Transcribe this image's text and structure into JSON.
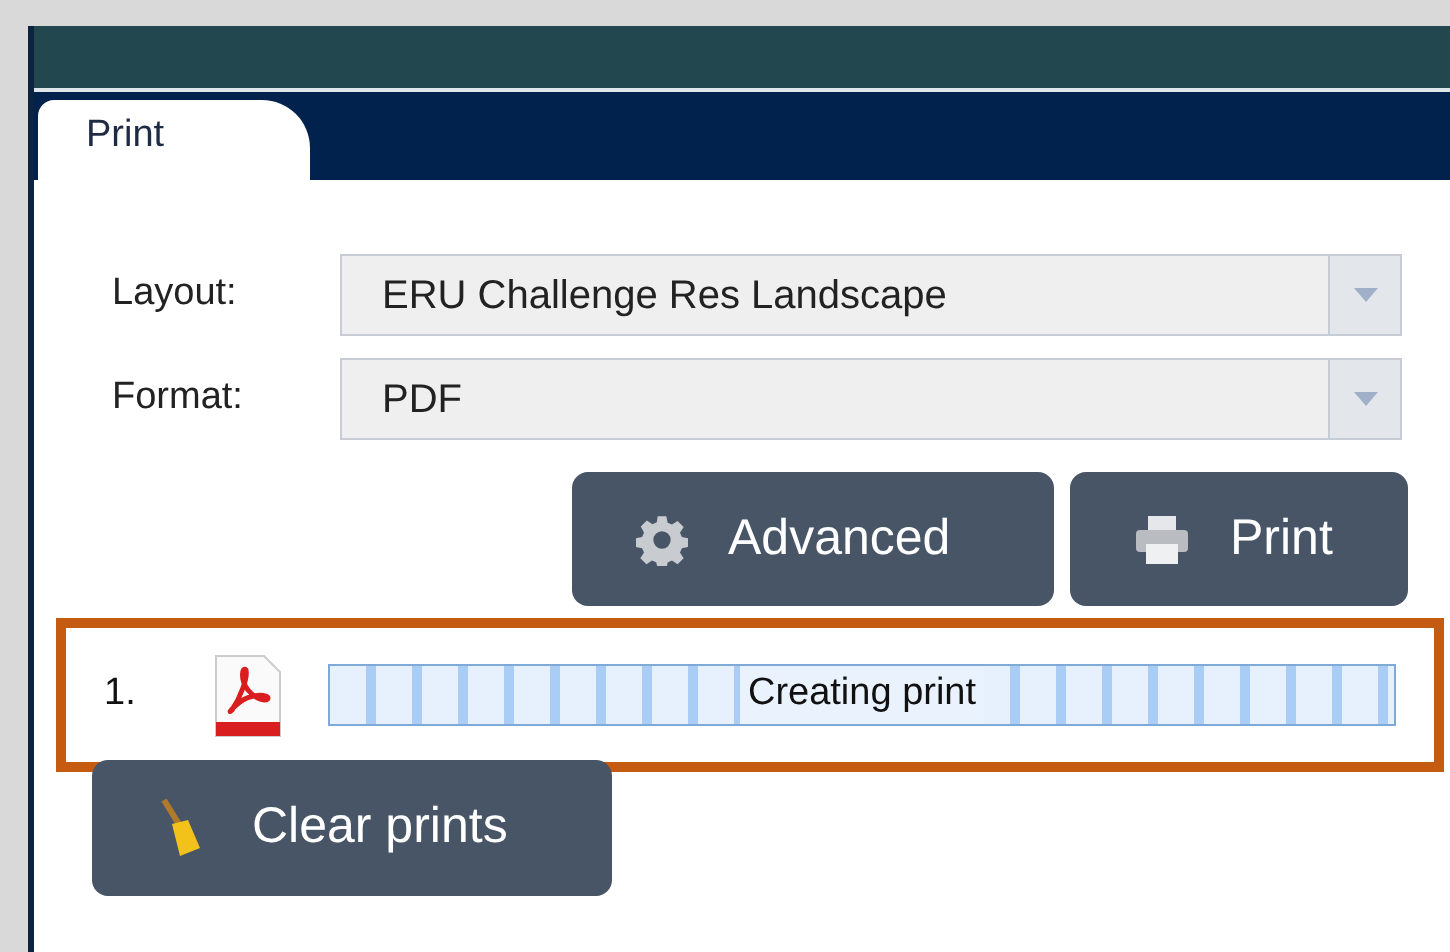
{
  "tabs": [
    {
      "label": "Print",
      "selected": true
    }
  ],
  "fields": [
    {
      "label": "Layout:",
      "value": "ERU Challenge Res Landscape"
    },
    {
      "label": "Format:",
      "value": "PDF"
    }
  ],
  "buttons": [
    {
      "kind": "settings",
      "label": "Advanced"
    },
    {
      "kind": "print",
      "label": "Print"
    }
  ],
  "print_jobs": [
    {
      "number": "1.",
      "status": "Creating print",
      "level": 1
    }
  ],
  "clear_button": {
    "label": "Clear prints"
  }
}
